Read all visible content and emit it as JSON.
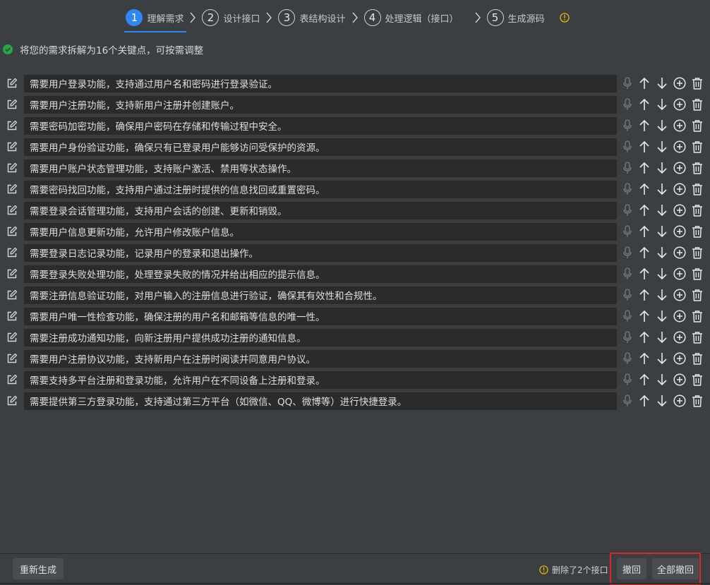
{
  "stepper": {
    "steps": [
      {
        "num": "1",
        "label": "理解需求",
        "active": true
      },
      {
        "num": "2",
        "label": "设计接口",
        "active": false
      },
      {
        "num": "3",
        "label": "表结构设计",
        "active": false
      },
      {
        "num": "4",
        "label": "处理逻辑（接口）",
        "active": false
      },
      {
        "num": "5",
        "label": "生成源码",
        "active": false
      }
    ],
    "info_icon": "info-circle-icon",
    "accent_color": "#2e87f5",
    "info_color": "#f0b400"
  },
  "status": {
    "text": "将您的需求拆解为16个关键点，可按需调整",
    "icon": "check-circle-icon",
    "icon_color": "#27a744"
  },
  "items": [
    "需要用户登录功能，支持通过用户名和密码进行登录验证。",
    "需要用户注册功能，支持新用户注册并创建账户。",
    "需要密码加密功能，确保用户密码在存储和传输过程中安全。",
    "需要用户身份验证功能，确保只有已登录用户能够访问受保护的资源。",
    "需要用户账户状态管理功能，支持账户激活、禁用等状态操作。",
    "需要密码找回功能，支持用户通过注册时提供的信息找回或重置密码。",
    "需要登录会话管理功能，支持用户会话的创建、更新和销毁。",
    "需要用户信息更新功能，允许用户修改账户信息。",
    "需要登录日志记录功能，记录用户的登录和退出操作。",
    "需要登录失败处理功能，处理登录失败的情况并给出相应的提示信息。",
    "需要注册信息验证功能，对用户输入的注册信息进行验证，确保其有效性和合规性。",
    "需要用户唯一性检查功能，确保注册的用户名和邮箱等信息的唯一性。",
    "需要注册成功通知功能，向新注册用户提供成功注册的通知信息。",
    "需要用户注册协议功能，支持新用户在注册时阅读并同意用户协议。",
    "需要支持多平台注册和登录功能，允许用户在不同设备上注册和登录。",
    "需要提供第三方登录功能，支持通过第三方平台（如微信、QQ、微博等）进行快捷登录。"
  ],
  "row_icons": [
    "edit-icon",
    "mic-icon",
    "arrow-up-icon",
    "arrow-down-icon",
    "plus-circle-icon",
    "trash-icon"
  ],
  "footer": {
    "regenerate_label": "重新生成",
    "note": "删除了2个接口",
    "undo_label": "撤回",
    "undo_all_label": "全部撤回",
    "highlight_color": "#e0242c"
  }
}
